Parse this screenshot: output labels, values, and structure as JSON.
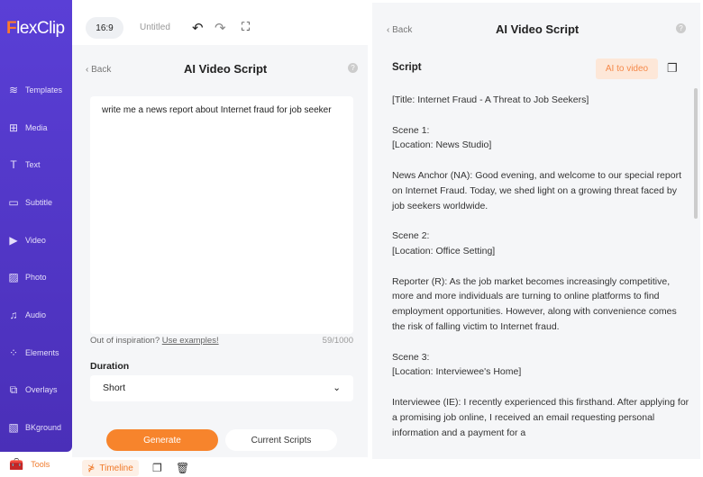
{
  "app": {
    "logo_f": "F",
    "logo_rest": "lexClip",
    "aspect_ratio": "16:9",
    "project_name": "Untitled"
  },
  "sidebar": {
    "items": [
      {
        "label": "Templates",
        "icon": "layers-icon"
      },
      {
        "label": "Media",
        "icon": "media-icon"
      },
      {
        "label": "Text",
        "icon": "text-icon"
      },
      {
        "label": "Subtitle",
        "icon": "subtitle-icon"
      },
      {
        "label": "Video",
        "icon": "video-icon"
      },
      {
        "label": "Photo",
        "icon": "photo-icon"
      },
      {
        "label": "Audio",
        "icon": "audio-icon"
      },
      {
        "label": "Elements",
        "icon": "elements-icon"
      },
      {
        "label": "Overlays",
        "icon": "overlays-icon"
      },
      {
        "label": "BKground",
        "icon": "background-icon"
      }
    ],
    "active": {
      "label": "Tools",
      "icon": "toolbox-icon"
    }
  },
  "left_panel": {
    "back": "Back",
    "title": "AI Video Script",
    "prompt": "write me a news report about Internet fraud for job seeker",
    "inspiration": "Out of inspiration?",
    "examples_link": "Use examples!",
    "char_count": "59/1000",
    "duration_label": "Duration",
    "duration_value": "Short",
    "generate": "Generate",
    "current_scripts": "Current Scripts"
  },
  "bottom": {
    "timeline": "Timeline"
  },
  "right_panel": {
    "back": "Back",
    "title": "AI Video Script",
    "script_label": "Script",
    "ai_to_video": "AI to video",
    "script": [
      "[Title: Internet Fraud - A Threat to Job Seekers]",
      "Scene 1:\n[Location: News Studio]",
      "News Anchor (NA): Good evening, and welcome to our special report on Internet Fraud. Today, we shed light on a growing threat faced by job seekers worldwide.",
      "Scene 2:\n[Location: Office Setting]",
      "Reporter (R): As the job market becomes increasingly competitive, more and more individuals are turning to online platforms to find employment opportunities. However, along with convenience comes the risk of falling victim to Internet fraud.",
      "Scene 3:\n[Location: Interviewee's Home]",
      "Interviewee (IE): I recently experienced this firsthand. After applying for a promising job online, I received an email requesting personal information and a payment for a"
    ]
  },
  "colors": {
    "sidebar": "#5a3fd6",
    "accent": "#f7842c"
  }
}
